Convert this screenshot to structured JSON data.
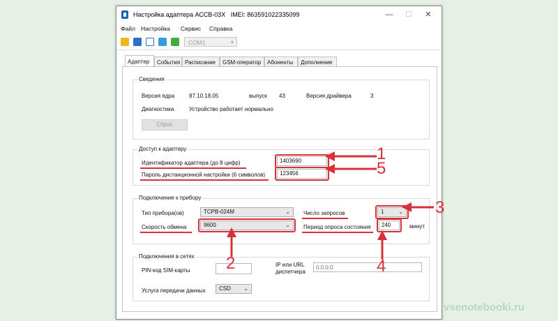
{
  "window": {
    "title": "Настройка адаптера АССВ-03Х   IMEI: 863591022335099",
    "minimize": "—",
    "maximize": "☐",
    "close": "✕"
  },
  "menu": [
    "Файл",
    "Настройка",
    "Сервис",
    "Справка"
  ],
  "toolbar": {
    "icons": [
      "open-folder-icon",
      "save-icon",
      "upload-icon",
      "arrow-left-icon",
      "arrow-right-icon"
    ],
    "com_port": "COM1"
  },
  "tabs": [
    "Адаптер",
    "События",
    "Расписание",
    "GSM-оператор",
    "Абоненты",
    "Дополнение"
  ],
  "info": {
    "title": "Сведения",
    "core_version_label": "Версия ядра",
    "core_version_value": "87.10.18.05",
    "release_label": "выпуск",
    "release_value": "43",
    "driver_label": "Версия драйвера",
    "driver_value": "3",
    "diag_label": "Диагностика",
    "diag_value": "Устройство работает нормально",
    "reset_button": "Сброс"
  },
  "access": {
    "title": "Доступ к адаптеру",
    "id_label": "Идентификатор адаптера (до 8 цифр)",
    "id_value": "1403690",
    "pwd_label": "Пароль дистанционной настройки (6 символов)",
    "pwd_value": "123456"
  },
  "device": {
    "title": "Подключение к прибору",
    "type_label": "Тип прибора(ов)",
    "type_value": "ТСРВ-024М",
    "speed_label": "Скорость обмена",
    "speed_value": "9600",
    "requests_label": "Число запросов",
    "requests_value": "1",
    "period_label": "Период опроса состояния",
    "period_value": "240",
    "period_unit": "минут"
  },
  "network": {
    "title": "Подключения в сетях",
    "pin_label": "PIN-код SIM-карты",
    "pin_value": "",
    "ip_label": "IP или URL диспетчера",
    "ip_placeholder": "0.0.0.0",
    "service_label": "Услуга передачи данных",
    "service_value": "CSD"
  },
  "annotations": {
    "one": "1",
    "two": "2",
    "three": "3",
    "four": "4",
    "five": "5"
  },
  "watermark": "vsenotebooki.ru",
  "colors": {
    "annotation_red": "#d6303a",
    "background": "#e6f1e6"
  }
}
